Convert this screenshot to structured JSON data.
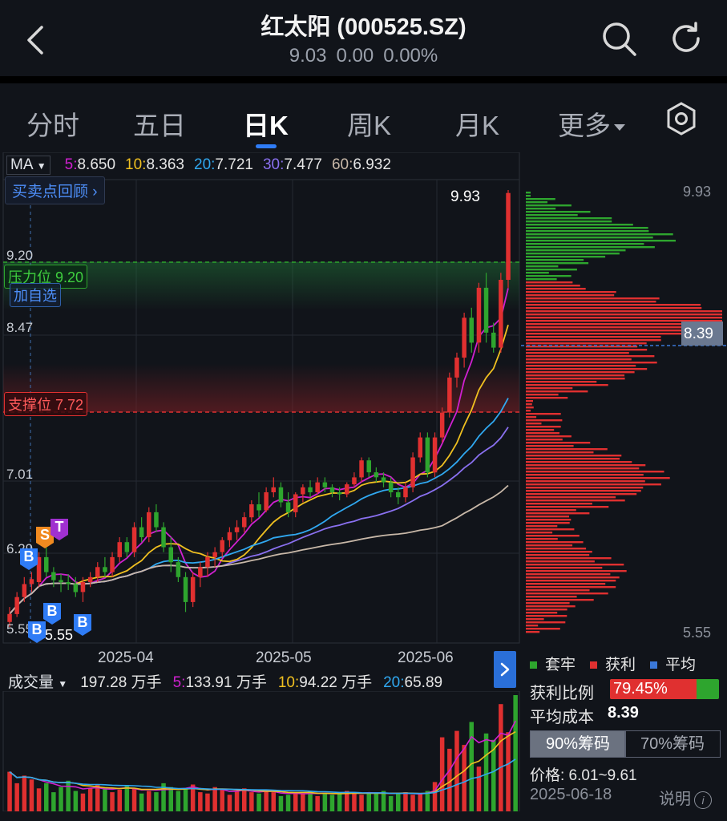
{
  "header": {
    "title": "红太阳 (000525.SZ)",
    "price": "9.03",
    "change": "0.00",
    "change_pct": "0.00%"
  },
  "tabs": [
    "分时",
    "五日",
    "日K",
    "周K",
    "月K",
    "更多"
  ],
  "active_tab": "日K",
  "ma": {
    "label": "MA",
    "ma5_key": "5",
    "ma5": "8.650",
    "ma10_key": "10",
    "ma10": "8.363",
    "ma20_key": "20",
    "ma20": "7.721",
    "ma30_key": "30",
    "ma30": "7.477",
    "ma60_key": "60",
    "ma60": "6.932"
  },
  "review_button": "买卖点回顾",
  "add_watchlist": "加自选",
  "pressure_label": "压力位 9.20",
  "support_label": "支撑位 7.72",
  "y_labels": {
    "l920": "9.20",
    "l847": "8.47",
    "l701": "7.01",
    "l629": "6.29",
    "l555": "5.55"
  },
  "high_label": "9.93",
  "low_label": "5.55",
  "x_labels": [
    "2025-04",
    "2025-05",
    "2025-06"
  ],
  "chip_axis": {
    "top": "9.93",
    "avg": "8.39",
    "bottom": "5.55"
  },
  "markers": {
    "b": "B",
    "s": "S",
    "t": "T"
  },
  "volume": {
    "label": "成交量",
    "value": "197.28 万手",
    "v5_key": "5",
    "v5": "133.91 万手",
    "v10_key": "10",
    "v10": "94.22 万手",
    "v20_key": "20",
    "v20": "65.89"
  },
  "legend": {
    "trapped": "套牢",
    "profit": "获利",
    "average": "平均"
  },
  "profit_ratio_label": "获利比例",
  "profit_ratio": "79.45%",
  "profit_ratio_value": 0.7945,
  "avg_cost_label": "平均成本",
  "avg_cost": "8.39",
  "chip_toggle": [
    "90%筹码",
    "70%筹码"
  ],
  "price_range": "价格: 6.01~9.61",
  "date": "2025-06-18",
  "explain": "说明",
  "colors": {
    "up": "#e03030",
    "down": "#2ea52e",
    "ma5": "#d020d0",
    "ma10": "#f0c020",
    "ma20": "#30a8f0",
    "ma30": "#8a70f0",
    "ma60": "#c8b8a8",
    "accent": "#2f7cf6"
  },
  "chart_data": {
    "type": "candlestick",
    "ylim": [
      5.55,
      9.93
    ],
    "x_ticks": [
      "2025-04",
      "2025-05",
      "2025-06"
    ],
    "candles": [
      {
        "o": 5.6,
        "h": 5.75,
        "l": 5.55,
        "c": 5.68
      },
      {
        "o": 5.68,
        "h": 5.9,
        "l": 5.65,
        "c": 5.85
      },
      {
        "o": 5.85,
        "h": 6.05,
        "l": 5.8,
        "c": 5.98
      },
      {
        "o": 5.98,
        "h": 6.1,
        "l": 5.9,
        "c": 6.03
      },
      {
        "o": 6.0,
        "h": 6.3,
        "l": 5.95,
        "c": 6.25
      },
      {
        "o": 6.25,
        "h": 6.4,
        "l": 6.05,
        "c": 6.1
      },
      {
        "o": 6.1,
        "h": 6.15,
        "l": 5.95,
        "c": 6.02
      },
      {
        "o": 6.02,
        "h": 6.08,
        "l": 5.9,
        "c": 6.0
      },
      {
        "o": 6.0,
        "h": 6.08,
        "l": 5.92,
        "c": 5.98
      },
      {
        "o": 5.98,
        "h": 6.05,
        "l": 5.85,
        "c": 5.9
      },
      {
        "o": 5.9,
        "h": 6.05,
        "l": 5.8,
        "c": 6.0
      },
      {
        "o": 6.0,
        "h": 6.1,
        "l": 5.95,
        "c": 6.05
      },
      {
        "o": 6.05,
        "h": 6.2,
        "l": 6.0,
        "c": 6.15
      },
      {
        "o": 6.15,
        "h": 6.25,
        "l": 6.05,
        "c": 6.1
      },
      {
        "o": 6.1,
        "h": 6.3,
        "l": 6.05,
        "c": 6.25
      },
      {
        "o": 6.25,
        "h": 6.45,
        "l": 6.2,
        "c": 6.4
      },
      {
        "o": 6.4,
        "h": 6.45,
        "l": 6.25,
        "c": 6.3
      },
      {
        "o": 6.3,
        "h": 6.6,
        "l": 6.25,
        "c": 6.55
      },
      {
        "o": 6.55,
        "h": 6.65,
        "l": 6.4,
        "c": 6.45
      },
      {
        "o": 6.45,
        "h": 6.75,
        "l": 6.4,
        "c": 6.7
      },
      {
        "o": 6.7,
        "h": 6.78,
        "l": 6.5,
        "c": 6.55
      },
      {
        "o": 6.55,
        "h": 6.6,
        "l": 6.3,
        "c": 6.35
      },
      {
        "o": 6.35,
        "h": 6.45,
        "l": 6.1,
        "c": 6.2
      },
      {
        "o": 6.2,
        "h": 6.25,
        "l": 6.0,
        "c": 6.05
      },
      {
        "o": 6.05,
        "h": 6.1,
        "l": 5.7,
        "c": 5.8
      },
      {
        "o": 5.8,
        "h": 6.1,
        "l": 5.75,
        "c": 6.05
      },
      {
        "o": 6.05,
        "h": 6.2,
        "l": 5.95,
        "c": 6.15
      },
      {
        "o": 6.15,
        "h": 6.3,
        "l": 6.05,
        "c": 6.25
      },
      {
        "o": 6.25,
        "h": 6.35,
        "l": 6.15,
        "c": 6.3
      },
      {
        "o": 6.3,
        "h": 6.45,
        "l": 6.25,
        "c": 6.42
      },
      {
        "o": 6.42,
        "h": 6.55,
        "l": 6.35,
        "c": 6.5
      },
      {
        "o": 6.5,
        "h": 6.62,
        "l": 6.42,
        "c": 6.55
      },
      {
        "o": 6.55,
        "h": 6.7,
        "l": 6.5,
        "c": 6.65
      },
      {
        "o": 6.65,
        "h": 6.82,
        "l": 6.6,
        "c": 6.78
      },
      {
        "o": 6.78,
        "h": 6.9,
        "l": 6.65,
        "c": 6.72
      },
      {
        "o": 6.72,
        "h": 6.95,
        "l": 6.7,
        "c": 6.9
      },
      {
        "o": 6.9,
        "h": 7.05,
        "l": 6.85,
        "c": 6.95
      },
      {
        "o": 6.95,
        "h": 7.0,
        "l": 6.75,
        "c": 6.8
      },
      {
        "o": 6.8,
        "h": 6.9,
        "l": 6.65,
        "c": 6.7
      },
      {
        "o": 6.7,
        "h": 6.9,
        "l": 6.65,
        "c": 6.88
      },
      {
        "o": 6.88,
        "h": 6.98,
        "l": 6.8,
        "c": 6.95
      },
      {
        "o": 6.95,
        "h": 7.02,
        "l": 6.85,
        "c": 6.9
      },
      {
        "o": 6.9,
        "h": 7.05,
        "l": 6.88,
        "c": 7.0
      },
      {
        "o": 7.0,
        "h": 7.05,
        "l": 6.9,
        "c": 6.95
      },
      {
        "o": 6.95,
        "h": 6.98,
        "l": 6.85,
        "c": 6.9
      },
      {
        "o": 6.9,
        "h": 6.95,
        "l": 6.82,
        "c": 6.88
      },
      {
        "o": 6.88,
        "h": 7.0,
        "l": 6.85,
        "c": 6.98
      },
      {
        "o": 6.98,
        "h": 7.1,
        "l": 6.95,
        "c": 7.05
      },
      {
        "o": 7.05,
        "h": 7.25,
        "l": 7.0,
        "c": 7.22
      },
      {
        "o": 7.22,
        "h": 7.25,
        "l": 7.05,
        "c": 7.1
      },
      {
        "o": 7.1,
        "h": 7.15,
        "l": 7.0,
        "c": 7.05
      },
      {
        "o": 7.05,
        "h": 7.1,
        "l": 6.95,
        "c": 7.0
      },
      {
        "o": 7.0,
        "h": 7.05,
        "l": 6.85,
        "c": 6.9
      },
      {
        "o": 6.9,
        "h": 6.95,
        "l": 6.78,
        "c": 6.85
      },
      {
        "o": 6.85,
        "h": 7.0,
        "l": 6.8,
        "c": 6.95
      },
      {
        "o": 6.95,
        "h": 7.3,
        "l": 6.9,
        "c": 7.25
      },
      {
        "o": 7.25,
        "h": 7.5,
        "l": 7.2,
        "c": 7.45
      },
      {
        "o": 7.45,
        "h": 7.5,
        "l": 7.05,
        "c": 7.1
      },
      {
        "o": 7.1,
        "h": 7.5,
        "l": 7.05,
        "c": 7.45
      },
      {
        "o": 7.45,
        "h": 7.75,
        "l": 7.4,
        "c": 7.7
      },
      {
        "o": 7.7,
        "h": 8.1,
        "l": 7.65,
        "c": 8.05
      },
      {
        "o": 8.05,
        "h": 8.3,
        "l": 7.95,
        "c": 8.25
      },
      {
        "o": 8.25,
        "h": 8.7,
        "l": 8.15,
        "c": 8.65
      },
      {
        "o": 8.65,
        "h": 8.75,
        "l": 8.3,
        "c": 8.4
      },
      {
        "o": 8.4,
        "h": 9.0,
        "l": 8.3,
        "c": 8.95
      },
      {
        "o": 8.95,
        "h": 9.1,
        "l": 8.4,
        "c": 8.5
      },
      {
        "o": 8.5,
        "h": 8.6,
        "l": 8.3,
        "c": 8.35
      },
      {
        "o": 8.35,
        "h": 9.1,
        "l": 8.3,
        "c": 9.03
      },
      {
        "o": 9.03,
        "h": 9.93,
        "l": 8.95,
        "c": 9.9
      }
    ],
    "volume": [
      3.1,
      2.2,
      2.8,
      2.5,
      1.8,
      2.2,
      1.5,
      1.9,
      2.4,
      1.6,
      1.4,
      1.8,
      2.1,
      1.9,
      1.5,
      1.7,
      2.0,
      1.8,
      1.4,
      1.6,
      1.5,
      2.2,
      1.9,
      1.6,
      1.8,
      2.1,
      1.5,
      1.4,
      1.9,
      1.7,
      1.3,
      1.6,
      1.8,
      1.5,
      1.4,
      1.6,
      1.5,
      1.2,
      1.3,
      1.5,
      1.4,
      1.6,
      1.2,
      1.4,
      1.3,
      1.5,
      1.6,
      1.4,
      1.3,
      1.5,
      1.4,
      1.6,
      1.2,
      1.4,
      1.5,
      1.3,
      1.4,
      1.6,
      2.3,
      5.8,
      4.9,
      6.3,
      5.2,
      7.0,
      3.5,
      6.1,
      5.6,
      8.4,
      6.2,
      9.1
    ]
  }
}
